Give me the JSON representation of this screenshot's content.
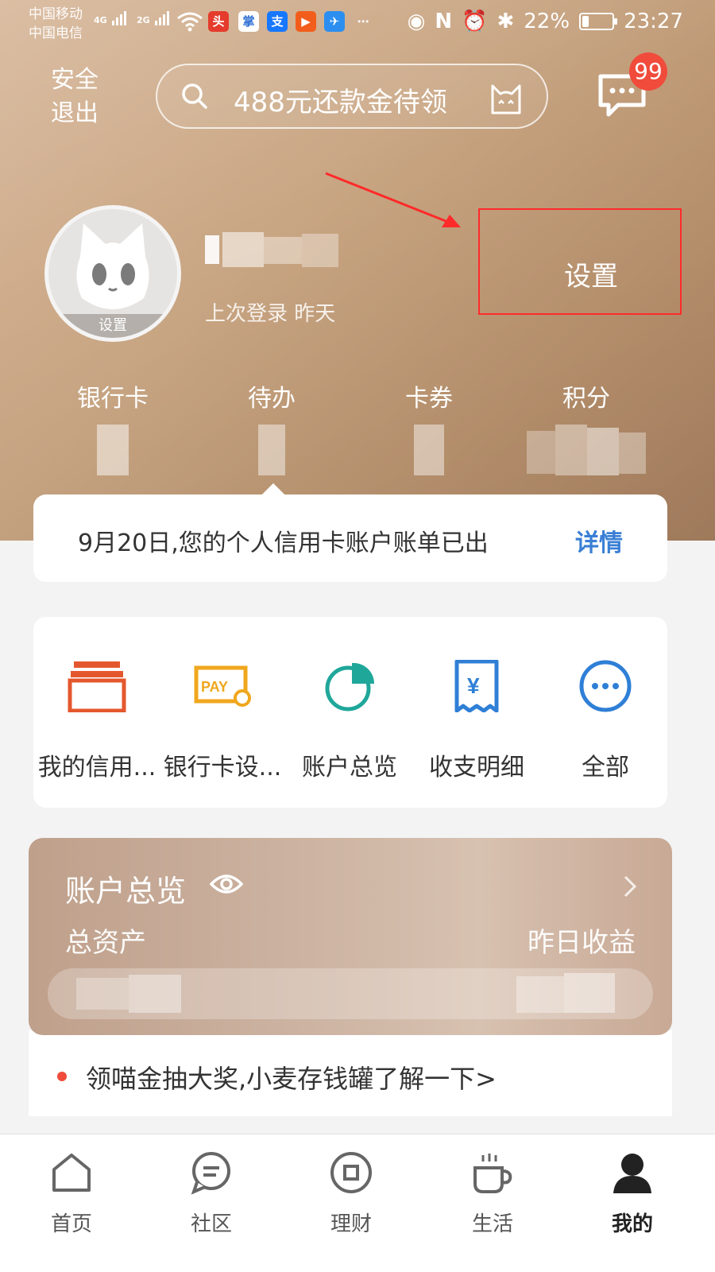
{
  "status_bar": {
    "carrier_1": "中国移动",
    "carrier_2": "中国电信",
    "signal_1": "4G",
    "signal_2": "2G",
    "battery": "22%",
    "battery_level": 0.22,
    "time": "23:27"
  },
  "header": {
    "logout_label": "安全退出",
    "search_placeholder": "488元还款金待领",
    "message_badge": "99"
  },
  "profile": {
    "avatar_label": "设置",
    "last_login": "上次登录 昨天",
    "settings_label": "设置"
  },
  "stats": [
    {
      "label": "银行卡"
    },
    {
      "label": "待办"
    },
    {
      "label": "卡券"
    },
    {
      "label": "积分"
    }
  ],
  "notice": {
    "text": "9月20日,您的个人信用卡账户账单已出",
    "link": "详情"
  },
  "quick_actions": [
    {
      "label": "我的信用...",
      "icon": "credit-card-icon",
      "color": "#e4572e"
    },
    {
      "label": "银行卡设...",
      "icon": "pay-card-icon",
      "color": "#f0a71d"
    },
    {
      "label": "账户总览",
      "icon": "pie-chart-icon",
      "color": "#1fa79a"
    },
    {
      "label": "收支明细",
      "icon": "receipt-icon",
      "color": "#2f7fd6"
    },
    {
      "label": "全部",
      "icon": "more-icon",
      "color": "#2f7fd6"
    }
  ],
  "overview": {
    "title": "账户总览",
    "total_label": "总资产",
    "yield_label": "昨日收益"
  },
  "promo": {
    "text": "领喵金抽大奖,小麦存钱罐了解一下>"
  },
  "tabs": [
    {
      "label": "首页",
      "icon": "home-icon"
    },
    {
      "label": "社区",
      "icon": "community-icon"
    },
    {
      "label": "理财",
      "icon": "finance-icon"
    },
    {
      "label": "生活",
      "icon": "life-icon"
    },
    {
      "label": "我的",
      "icon": "profile-icon",
      "active": true
    }
  ]
}
